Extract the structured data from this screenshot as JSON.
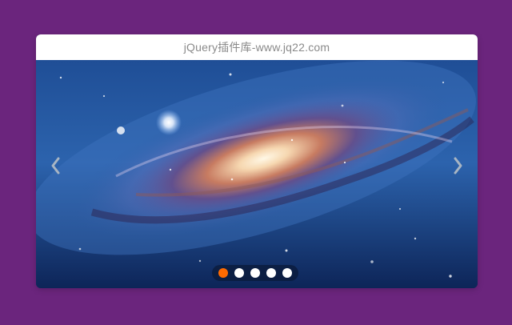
{
  "header": {
    "title": "jQuery插件库-www.jq22.com"
  },
  "slider": {
    "image_subject": "galaxy-image",
    "prev_icon": "chevron-left-icon",
    "next_icon": "chevron-right-icon",
    "active_index": 1,
    "dot_count": 5,
    "colors": {
      "page_background": "#6b257d",
      "active_dot": "#ff6a00",
      "inactive_dot": "#ffffff",
      "title_text": "#8a8a8a"
    }
  }
}
